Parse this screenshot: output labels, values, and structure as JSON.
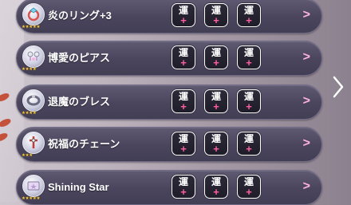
{
  "items": [
    {
      "name": "炎のリング+3",
      "icon": "ring-icon",
      "stars": "★★★★★",
      "luck_label": "運",
      "plus": "+"
    },
    {
      "name": "博愛のピアス",
      "icon": "earring-icon",
      "stars": "★★★★",
      "luck_label": "運",
      "plus": "+"
    },
    {
      "name": "退魔のブレス",
      "icon": "bracelet-icon",
      "stars": "★★★★",
      "luck_label": "運",
      "plus": "+"
    },
    {
      "name": "祝福のチェーン",
      "icon": "chain-icon",
      "stars": "★★★",
      "luck_label": "運",
      "plus": "+"
    },
    {
      "name": "Shining Star",
      "icon": "star-card-icon",
      "stars": "★★★★★",
      "luck_label": "運",
      "plus": "+"
    }
  ],
  "chevron": ">",
  "colors": {
    "row_bg": "#4a455d",
    "plus": "#ff5fa2",
    "chevron": "#ffb3e0",
    "stars": "#f5c842"
  }
}
